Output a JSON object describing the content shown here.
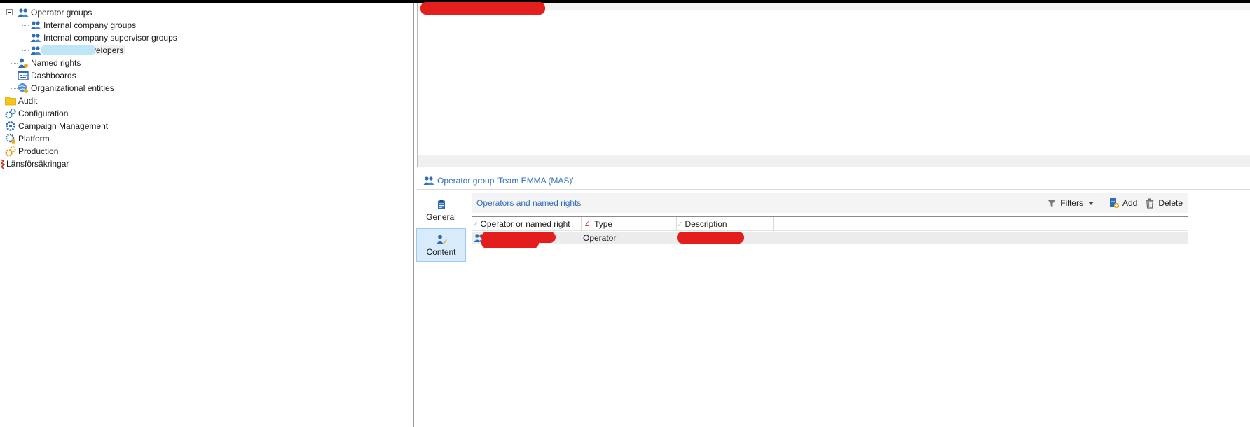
{
  "tree": {
    "items": [
      {
        "label": "Operator groups"
      },
      {
        "label": "Internal company groups"
      },
      {
        "label": "Internal company supervisor groups"
      },
      {
        "label": "velopers"
      },
      {
        "label": "Named rights"
      },
      {
        "label": "Dashboards"
      },
      {
        "label": "Organizational entities"
      },
      {
        "label": "Audit"
      },
      {
        "label": "Configuration"
      },
      {
        "label": "Campaign Management"
      },
      {
        "label": "Platform"
      },
      {
        "label": "Production"
      },
      {
        "label": "Länsförsäkringar"
      }
    ]
  },
  "detail": {
    "title": "Operator group 'Team EMMA (MAS)'",
    "tabs": [
      {
        "label": "General"
      },
      {
        "label": "Content"
      }
    ],
    "section_title": "Operators and named rights",
    "toolbar": {
      "filters_label": "Filters",
      "add_label": "Add",
      "delete_label": "Delete"
    },
    "columns": [
      {
        "label": "Operator or named right"
      },
      {
        "label": "Type"
      },
      {
        "label": "Description"
      }
    ],
    "rows": [
      {
        "type": "Operator"
      }
    ]
  },
  "colors": {
    "accent": "#2f6db5",
    "selected_tab_bg": "#d7ebfa",
    "redaction_red": "#e41d1d",
    "redaction_blue": "#bfe6f7"
  },
  "icons": [
    "operator-group-icon",
    "named-rights-icon",
    "dashboards-icon",
    "organizational-entities-icon",
    "folder-icon",
    "gear-icon",
    "clipboard-icon",
    "edit-user-icon",
    "filter-icon",
    "add-icon",
    "trash-icon"
  ]
}
